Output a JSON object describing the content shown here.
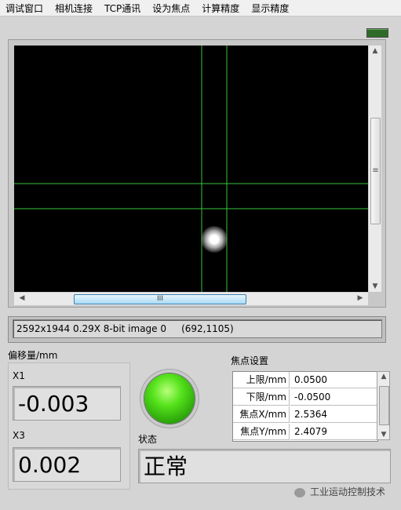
{
  "menu": {
    "items": [
      "调试窗口",
      "相机连接",
      "TCP通讯",
      "设为焦点",
      "计算精度",
      "显示精度"
    ]
  },
  "image_status_text": "2592x1944 0.29X 8-bit image 0     (692,1105)",
  "offset": {
    "title": "偏移量/mm",
    "x1_label": "X1",
    "x1_value": "-0.003",
    "x3_label": "X3",
    "x3_value": "0.002"
  },
  "focus_settings": {
    "title": "焦点设置",
    "rows": [
      {
        "label": "上限/mm",
        "value": "0.0500"
      },
      {
        "label": "下限/mm",
        "value": "-0.0500"
      },
      {
        "label": "焦点X/mm",
        "value": "2.5364"
      },
      {
        "label": "焦点Y/mm",
        "value": "2.4079"
      }
    ]
  },
  "status": {
    "label": "状态",
    "value": "正常",
    "indicator_color": "#3dcc16"
  },
  "watermark": "工业运动控制技术",
  "colors": {
    "crosshair": "#39c43a",
    "canvas_bg": "#000000"
  }
}
